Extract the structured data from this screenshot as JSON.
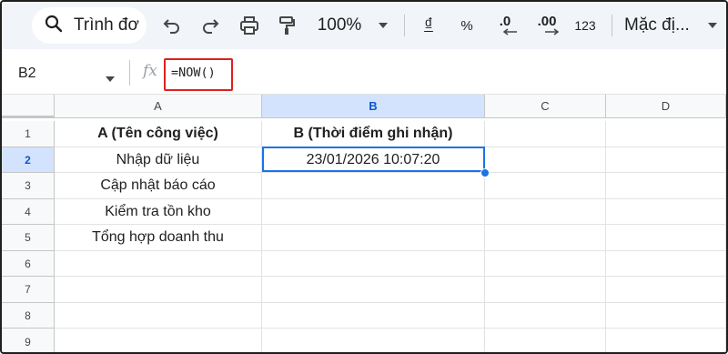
{
  "toolbar": {
    "search_label": "Trình đơ",
    "zoom": "100%",
    "currency_symbol": "₫",
    "percent": "%",
    "decrease_decimal": ".0",
    "increase_decimal": ".00",
    "number_format": "123",
    "font_name": "Mặc đị..."
  },
  "formula_bar": {
    "name_box": "B2",
    "fx_label": "fx",
    "formula": "=NOW()"
  },
  "sheet": {
    "columns": [
      "A",
      "B",
      "C",
      "D"
    ],
    "rows": [
      "1",
      "2",
      "3",
      "4",
      "5",
      "6",
      "7",
      "8",
      "9"
    ],
    "cells": {
      "A1": "A (Tên công việc)",
      "B1": "B (Thời điểm ghi nhận)",
      "A2": "Nhập dữ liệu",
      "B2": "23/01/2026 10:07:20",
      "A3": "Cập nhật báo cáo",
      "A4": "Kiểm tra tồn kho",
      "A5": "Tổng hợp doanh thu"
    },
    "selected_cell": "B2"
  },
  "colors": {
    "selection": "#1a73e8",
    "highlight_header": "#d3e3fd",
    "formula_outline": "#e0201f"
  }
}
